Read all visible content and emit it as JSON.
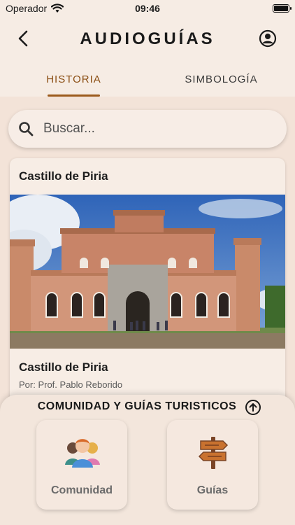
{
  "status_bar": {
    "carrier": "Operador",
    "time": "09:46"
  },
  "header": {
    "title": "AUDIOGUÍAS"
  },
  "tabs": [
    {
      "label": "HISTORIA",
      "active": true
    },
    {
      "label": "SIMBOLOGÍA",
      "active": false
    }
  ],
  "search": {
    "placeholder": "Buscar..."
  },
  "card": {
    "header_title": "Castillo de Piria",
    "title": "Castillo de Piria",
    "author": "Por: Prof. Pablo Reborido"
  },
  "bottom_sheet": {
    "title": "COMUNIDAD Y GUÍAS TURISTICOS",
    "tiles": [
      {
        "label": "Comunidad",
        "icon": "community-icon"
      },
      {
        "label": "Guías",
        "icon": "signpost-icon"
      }
    ]
  },
  "colors": {
    "accent": "#9b5a1c",
    "background": "#f3e3d8"
  }
}
